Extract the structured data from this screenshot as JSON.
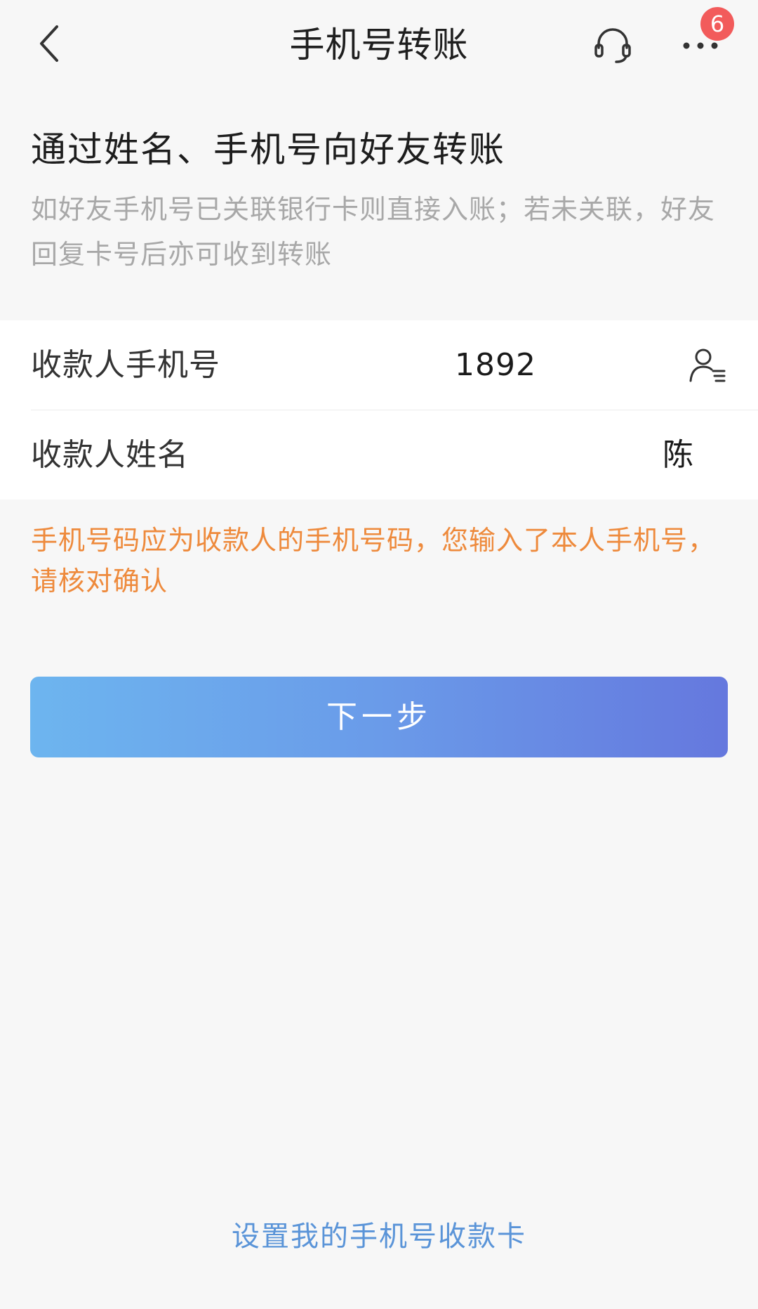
{
  "nav": {
    "title": "手机号转账",
    "badge_count": "6",
    "icons": [
      "back-chevron-icon",
      "headset-icon",
      "more-dots-icon"
    ]
  },
  "intro": {
    "title": "通过姓名、手机号向好友转账",
    "description": "如好友手机号已关联银行卡则直接入账；若未关联，好友回复卡号后亦可收到转账"
  },
  "form": {
    "phone_label": "收款人手机号",
    "phone_value": "1892",
    "name_label": "收款人姓名",
    "name_value": "陈",
    "contact_icon": "contact-list-icon"
  },
  "warning": "手机号码应为收款人的手机号码，您输入了本人手机号，请核对确认",
  "next_button": "下一步",
  "footer_link": "设置我的手机号收款卡",
  "colors": {
    "background": "#f7f7f7",
    "warning": "#ee8a3c",
    "link": "#5a94d8",
    "button_start": "#6db5ef",
    "button_end": "#6578de",
    "badge": "#f25b5b"
  }
}
